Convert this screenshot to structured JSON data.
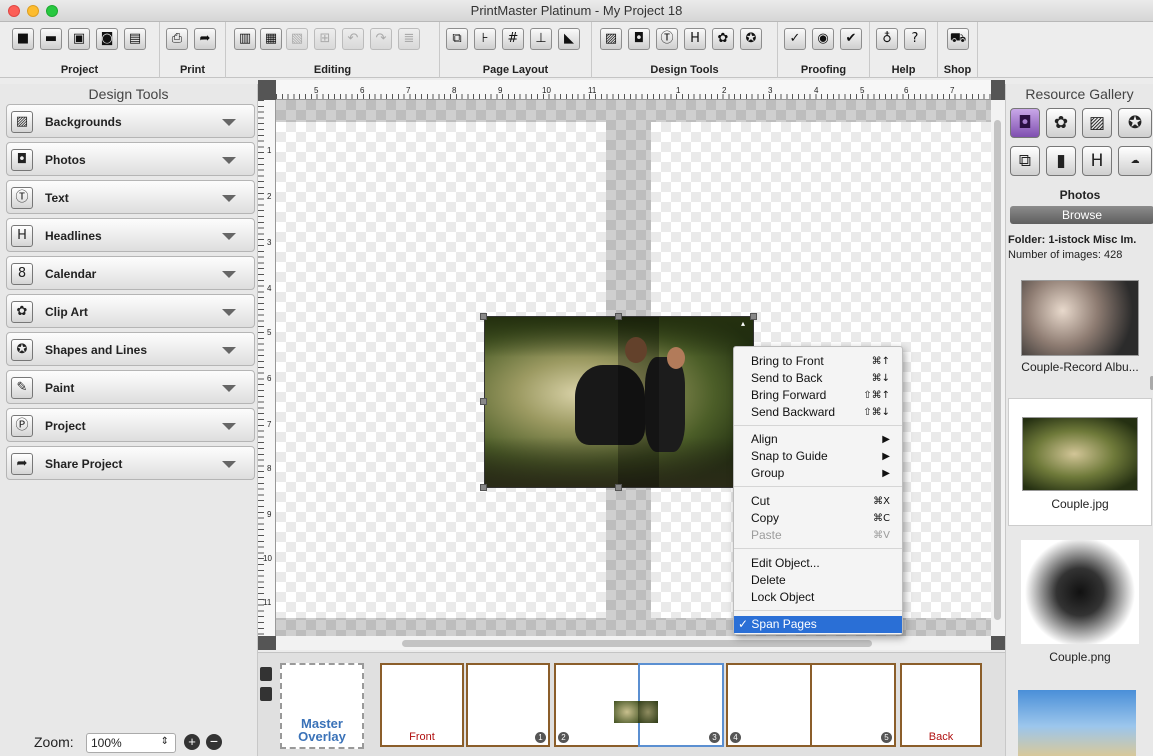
{
  "window": {
    "title": "PrintMaster Platinum - My Project 18"
  },
  "toolbar": {
    "groups": [
      {
        "label": "Project"
      },
      {
        "label": "Print"
      },
      {
        "label": "Editing"
      },
      {
        "label": "Page Layout"
      },
      {
        "label": "Design Tools"
      },
      {
        "label": "Proofing"
      },
      {
        "label": "Help"
      },
      {
        "label": "Shop"
      }
    ]
  },
  "design_tools": {
    "title": "Design Tools",
    "items": [
      {
        "label": "Backgrounds",
        "icon": "image-icon"
      },
      {
        "label": "Photos",
        "icon": "camera-icon"
      },
      {
        "label": "Text",
        "icon": "text-icon"
      },
      {
        "label": "Headlines",
        "icon": "headline-icon"
      },
      {
        "label": "Calendar",
        "icon": "calendar-icon"
      },
      {
        "label": "Clip Art",
        "icon": "flower-icon"
      },
      {
        "label": "Shapes and Lines",
        "icon": "star-icon"
      },
      {
        "label": "Paint",
        "icon": "brush-icon"
      },
      {
        "label": "Project",
        "icon": "project-icon"
      },
      {
        "label": "Share Project",
        "icon": "share-icon"
      }
    ]
  },
  "zoom": {
    "label": "Zoom:",
    "value": "100%"
  },
  "ruler": {
    "top_labels": [
      "5",
      "6",
      "7",
      "8",
      "9",
      "10",
      "11",
      "1",
      "2",
      "3",
      "4",
      "5",
      "6",
      "7"
    ],
    "left_labels": [
      "1",
      "2",
      "3",
      "4",
      "5",
      "6",
      "7",
      "8",
      "9",
      "10",
      "11"
    ]
  },
  "context_menu": {
    "items": [
      {
        "label": "Bring to Front",
        "shortcut": "⌘↑"
      },
      {
        "label": "Send to Back",
        "shortcut": "⌘↓"
      },
      {
        "label": "Bring Forward",
        "shortcut": "⇧⌘↑"
      },
      {
        "label": "Send Backward",
        "shortcut": "⇧⌘↓"
      },
      {
        "label": "Align",
        "shortcut": "▶"
      },
      {
        "label": "Snap to Guide",
        "shortcut": "▶"
      },
      {
        "label": "Group",
        "shortcut": "▶"
      },
      {
        "label": "Cut",
        "shortcut": "⌘X"
      },
      {
        "label": "Copy",
        "shortcut": "⌘C"
      },
      {
        "label": "Paste",
        "shortcut": "⌘V"
      },
      {
        "label": "Edit Object...",
        "shortcut": ""
      },
      {
        "label": "Delete",
        "shortcut": ""
      },
      {
        "label": "Lock Object",
        "shortcut": ""
      },
      {
        "label": "✓ Span Pages",
        "shortcut": ""
      }
    ]
  },
  "page_strip": {
    "master": {
      "line1": "Master",
      "line2": "Overlay"
    },
    "front": "Front",
    "back": "Back",
    "numbers": [
      "1",
      "2",
      "3",
      "4",
      "5"
    ]
  },
  "resource_gallery": {
    "title": "Resource Gallery",
    "section": "Photos",
    "browse": "Browse",
    "folder": "Folder: 1-istock Misc Im.",
    "count": "Number of images: 428",
    "items": [
      {
        "name": "Couple-Record Albu..."
      },
      {
        "name": "Couple.jpg"
      },
      {
        "name": "Couple.png"
      }
    ]
  },
  "colors": {
    "selection": "#2a6fd6",
    "thumb_border": "#8b5e2a",
    "label_red": "#b01010"
  }
}
